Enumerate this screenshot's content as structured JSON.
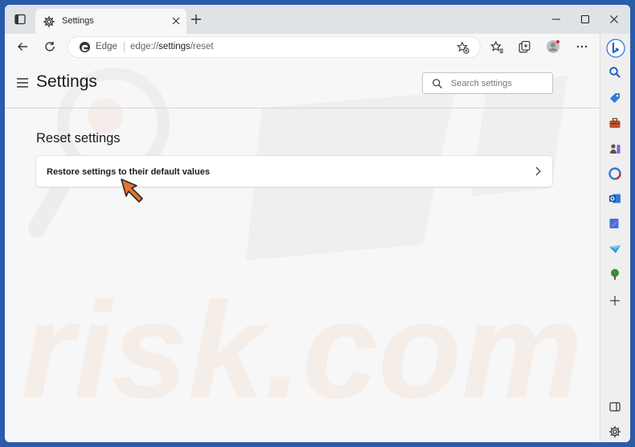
{
  "tab": {
    "title": "Settings"
  },
  "address": {
    "site": "Edge",
    "url_prefix": "edge://",
    "url_bold": "settings",
    "url_suffix": "/reset"
  },
  "header": {
    "title": "Settings"
  },
  "search": {
    "placeholder": "Search settings"
  },
  "section": {
    "title": "Reset settings"
  },
  "reset_card": {
    "label": "Restore settings to their default values"
  },
  "watermark": {
    "text": "risk.com"
  },
  "colors": {
    "accent": "#0f6cbd",
    "window_frame": "#2a5cab",
    "arrow": "#e8742c"
  },
  "icons": {
    "toolbar": [
      "back-icon",
      "refresh-icon",
      "edge-logo-icon",
      "add-favorite-icon",
      "favorites-icon",
      "collections-icon",
      "profile-avatar-icon",
      "more-icon"
    ],
    "sidebar": [
      "bing-copilot-icon",
      "search-icon",
      "shopping-tag-icon",
      "tools-icon",
      "games-icon",
      "office-icon",
      "outlook-icon",
      "designer-icon",
      "drop-icon",
      "tree-icon",
      "add-icon",
      "sidebar-toggle-icon",
      "settings-icon"
    ]
  }
}
